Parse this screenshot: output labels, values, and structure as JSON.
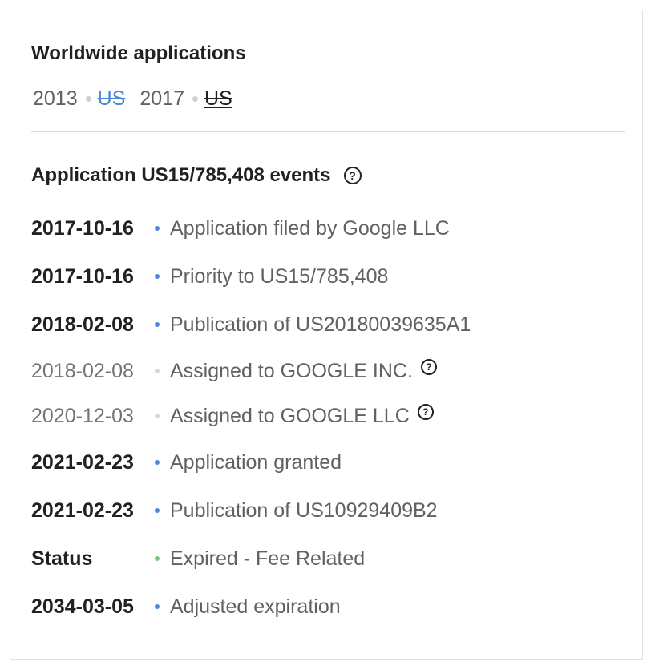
{
  "worldwide": {
    "title": "Worldwide applications",
    "entries": [
      {
        "year": "2013",
        "country": "US"
      },
      {
        "year": "2017",
        "country": "US"
      }
    ]
  },
  "events_section": {
    "title": "Application US15/785,408 events",
    "help_icon": "help-circle-icon",
    "items": [
      {
        "date": "2017-10-16",
        "text": "Application filed by Google LLC"
      },
      {
        "date": "2017-10-16",
        "text": "Priority to US15/785,408"
      },
      {
        "date": "2018-02-08",
        "text": "Publication of US20180039635A1"
      },
      {
        "date": "2018-02-08",
        "text": "Assigned to GOOGLE INC."
      },
      {
        "date": "2020-12-03",
        "text": "Assigned to GOOGLE LLC"
      },
      {
        "date": "2021-02-23",
        "text": "Application granted"
      },
      {
        "date": "2021-02-23",
        "text": "Publication of US10929409B2"
      },
      {
        "date": "Status",
        "text": "Expired - Fee Related"
      },
      {
        "date": "2034-03-05",
        "text": "Adjusted expiration"
      }
    ]
  },
  "colors": {
    "link_blue": "#4a86d8",
    "status_green": "#7cc47f",
    "muted_dot": "#d6d6d6"
  }
}
